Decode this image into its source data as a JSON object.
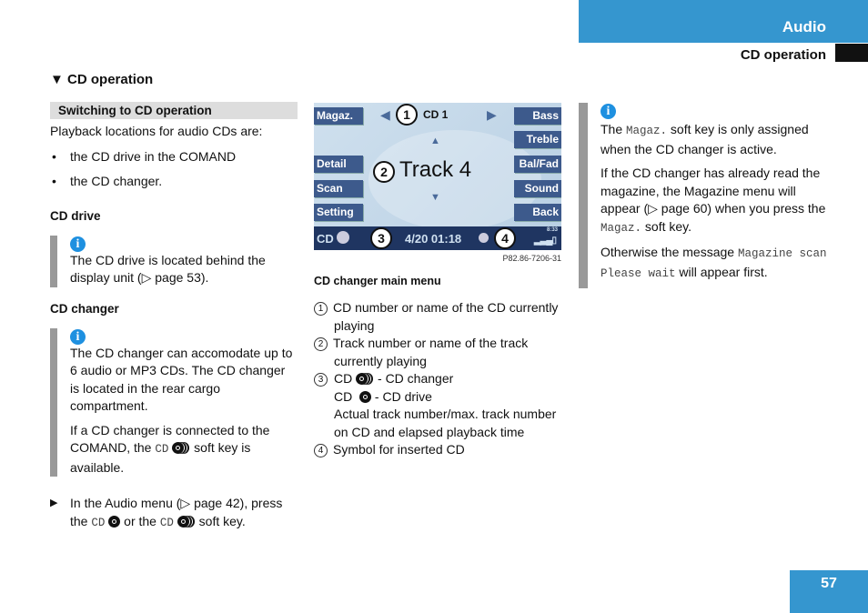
{
  "header": {
    "section": "Audio",
    "subsection": "CD operation",
    "page_number": "57"
  },
  "left": {
    "heading": "CD operation",
    "subheading": "Switching to CD operation",
    "intro": "Playback locations for audio CDs are:",
    "bullets": [
      "the CD drive in the COMAND",
      "the CD changer."
    ],
    "cd_drive": {
      "title": "CD drive",
      "note": "The CD drive is located behind the display unit (▷ page 53)."
    },
    "cd_changer": {
      "title": "CD changer",
      "note1": "The CD changer can accomodate up to 6 audio or MP3 CDs. The CD changer is located in the rear cargo compartment.",
      "note2_a": "If a CD changer is connected to the COMAND, the",
      "note2_key": "CD",
      "note2_b": "soft key is available."
    },
    "step": {
      "a": "In the Audio menu (▷ page 42), press the",
      "key1": "CD",
      "b": "or the",
      "key2": "CD",
      "c": "soft key."
    }
  },
  "screen": {
    "left_keys": [
      "Magaz.",
      "Detail",
      "Scan",
      "Setting"
    ],
    "right_keys": [
      "Bass",
      "Treble",
      "Bal/Fad",
      "Sound",
      "Back"
    ],
    "cd": "CD 1",
    "track": "Track 4",
    "status_cd": "CD",
    "status": "4/20  01:18",
    "clock": "8:33",
    "callouts": [
      "1",
      "2",
      "3",
      "4"
    ],
    "ref": "P82.86-7206-31",
    "caption": "CD changer main menu"
  },
  "legend": [
    {
      "n": "1",
      "text": "CD number or name of the CD currently playing"
    },
    {
      "n": "2",
      "text": "Track number or name of the track currently playing"
    },
    {
      "n": "3",
      "l1_key": "CD",
      "l1": "- CD changer",
      "l2_key": "CD",
      "l2": "- CD drive",
      "l3": "Actual track number/max. track number on CD and elapsed playback time"
    },
    {
      "n": "4",
      "text": "Symbol for inserted CD"
    }
  ],
  "right": {
    "p1_a": "The",
    "p1_key": "Magaz.",
    "p1_b": "soft key is only assigned when the CD changer is active.",
    "p2_a": "If the CD changer has already read the magazine, the Magazine menu will appear (▷ page 60) when you press the",
    "p2_key": "Magaz.",
    "p2_b": "soft key.",
    "p3_a": "Otherwise the message",
    "p3_key": "Magazine scan Please wait",
    "p3_b": "will appear first."
  },
  "colors": {
    "accent": "#3596cf",
    "note_bar": "#999999",
    "info_icon": "#1e90e0"
  }
}
